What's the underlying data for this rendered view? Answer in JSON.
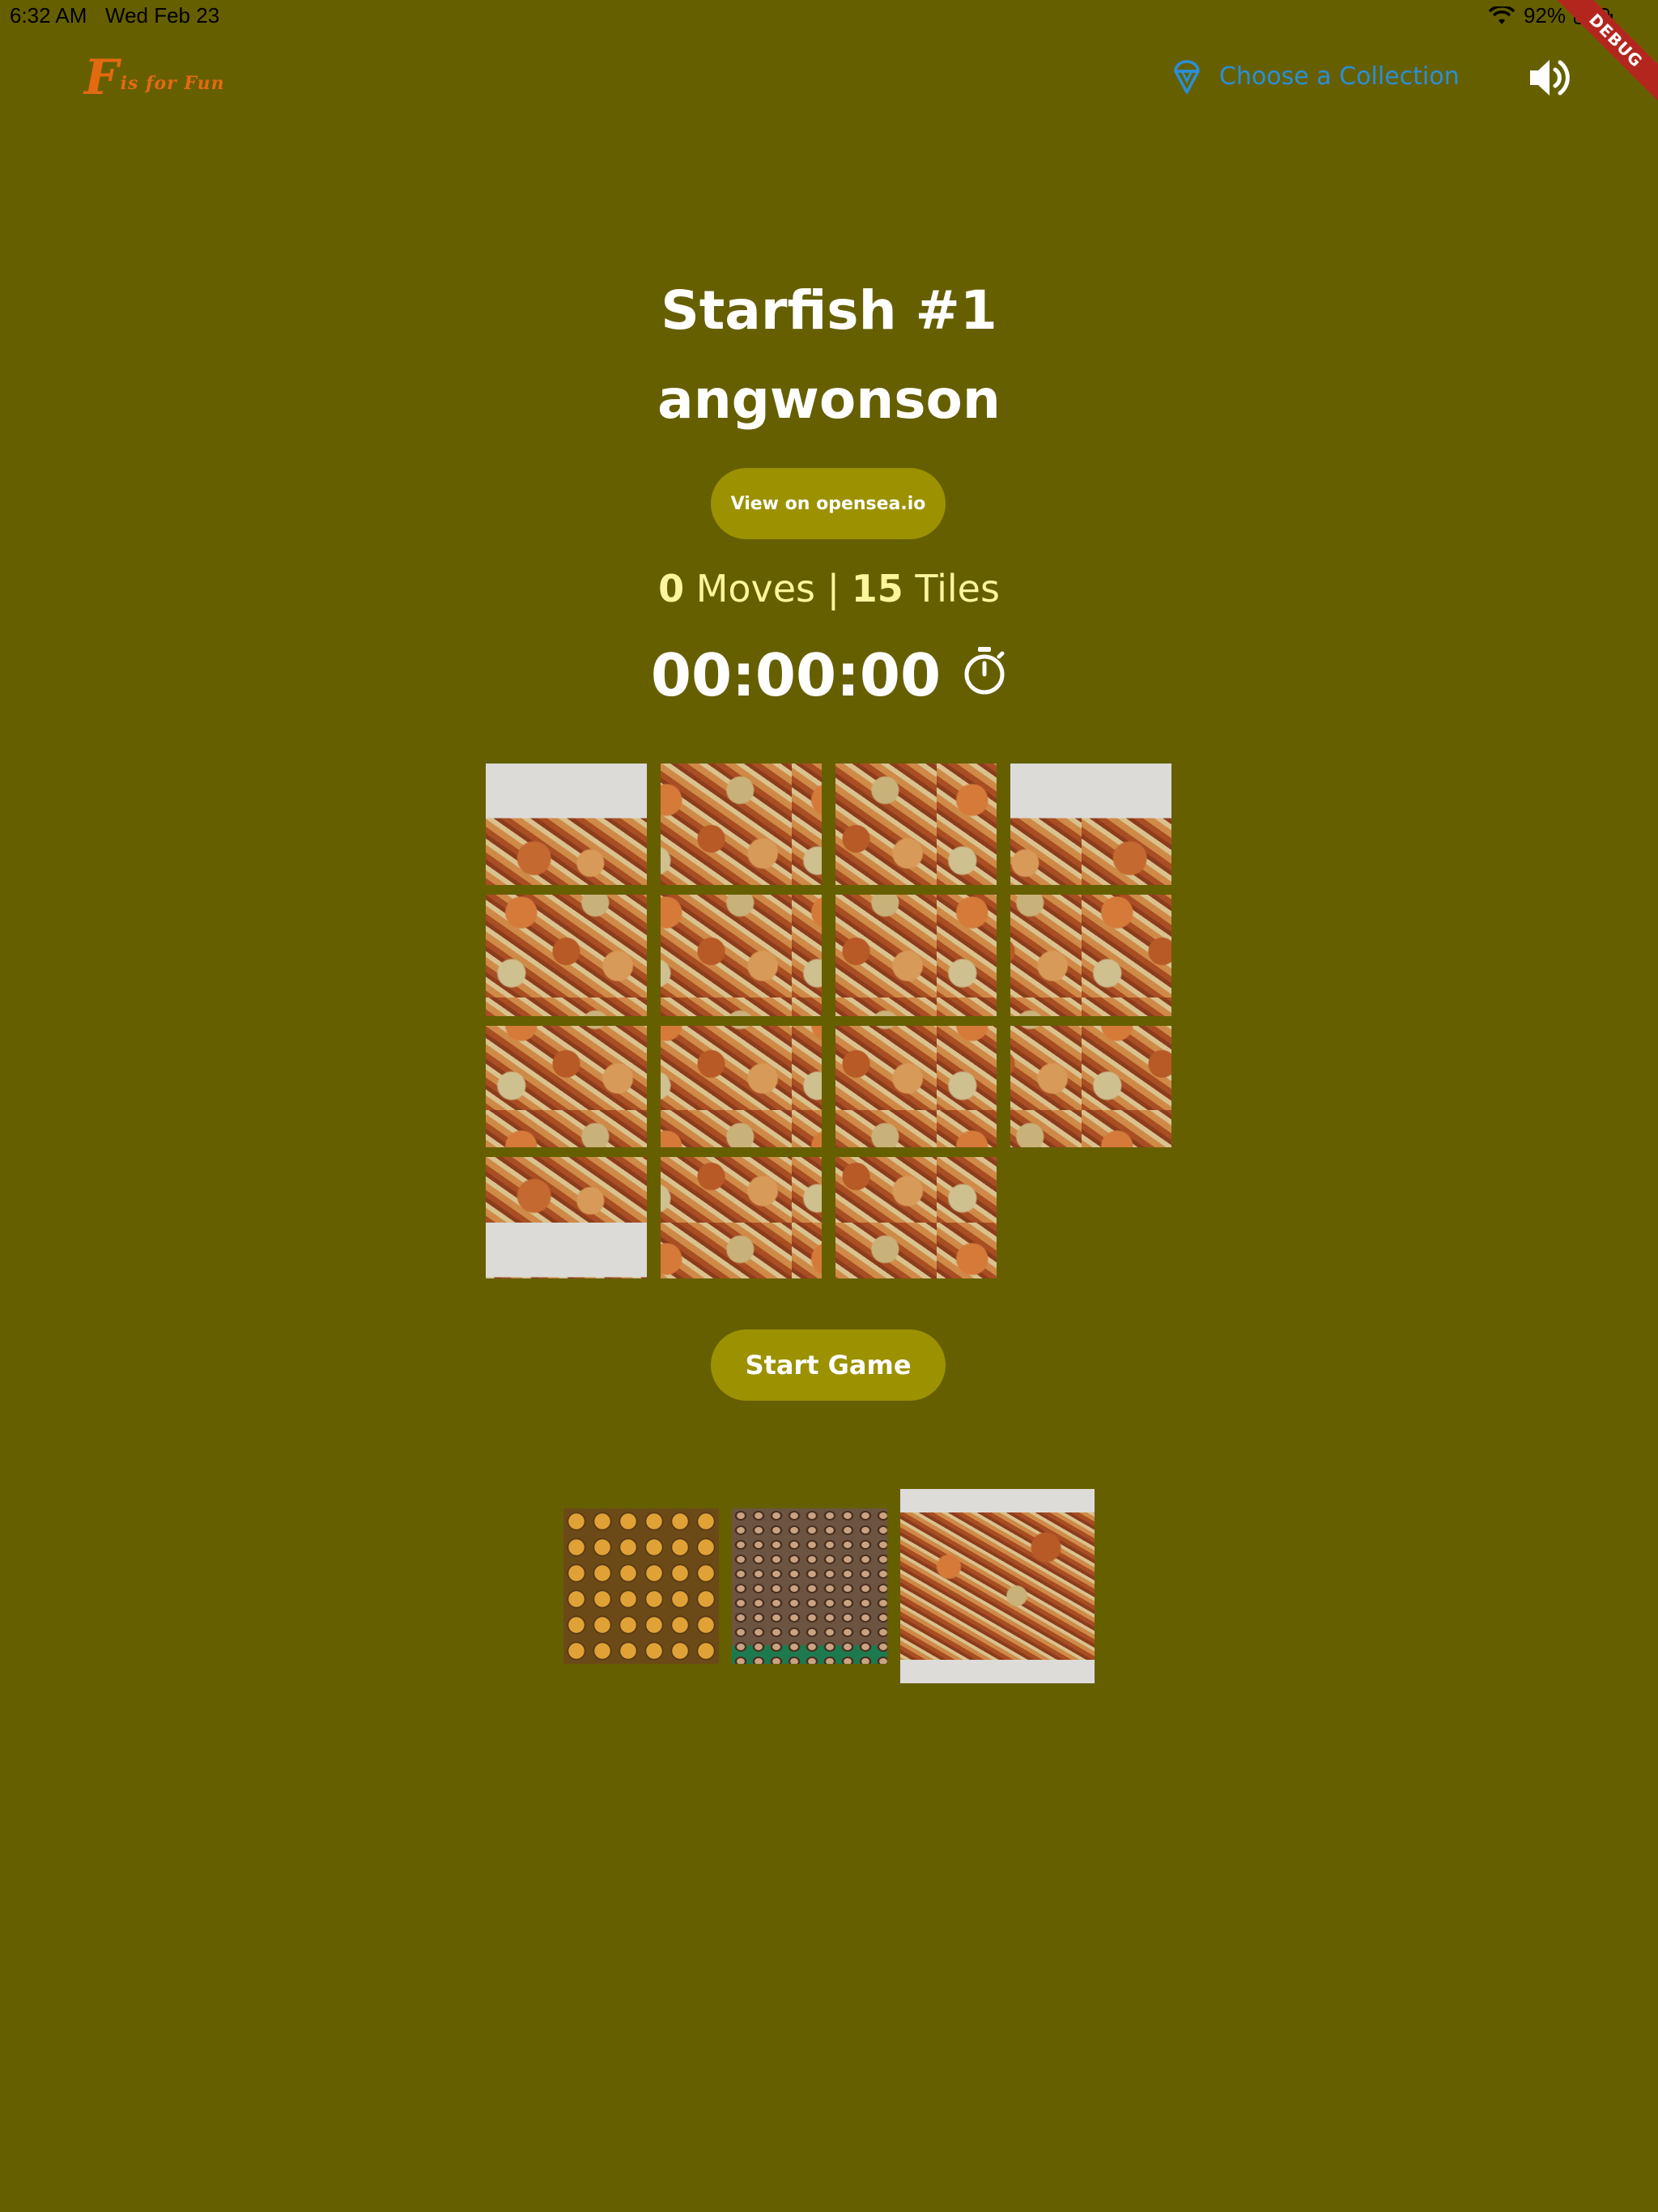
{
  "status_bar": {
    "time": "6:32 AM",
    "date": "Wed Feb 23",
    "battery": "92%"
  },
  "debug_banner": "DEBUG",
  "header": {
    "logo_initial": "F",
    "logo_text": "is for Fun",
    "collection_link": "Choose a Collection",
    "collection_icon": "ice-cream-icon",
    "sound_icon": "volume-up-icon"
  },
  "artwork": {
    "title": "Starfish #1",
    "creator": "angwonson",
    "opensea_button": "View on opensea.io"
  },
  "stats": {
    "moves": "0",
    "moves_label": "Moves",
    "separator": "|",
    "tiles": "15",
    "tiles_label": "Tiles"
  },
  "timer": {
    "value": "00:00:00",
    "icon": "stopwatch-icon"
  },
  "board": {
    "rows": 4,
    "cols": 4,
    "tiles": [
      1,
      2,
      3,
      4,
      5,
      6,
      7,
      8,
      9,
      10,
      11,
      12,
      13,
      14,
      15
    ],
    "empty_slot": 16
  },
  "start_button": "Start Game",
  "thumbnails": [
    "sea-urchins",
    "shells",
    "starfish"
  ],
  "colors": {
    "background": "#665f00",
    "button": "#9c9100",
    "accent_text": "#fff59d",
    "link": "#2a8fd8",
    "logo": "#e36a10"
  }
}
